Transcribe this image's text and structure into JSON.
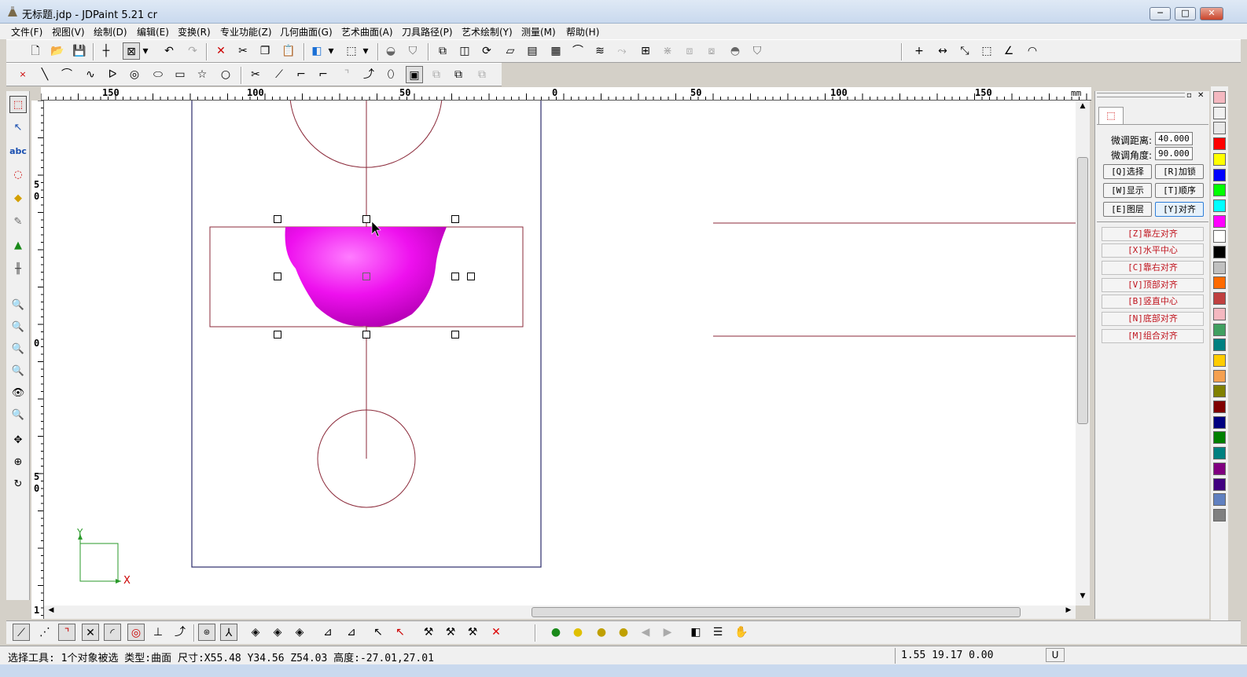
{
  "window": {
    "title": "无标题.jdp - JDPaint 5.21 cr",
    "minimize": "─",
    "maximize": "□",
    "close": "✕"
  },
  "menu": [
    "文件(F)",
    "视图(V)",
    "绘制(D)",
    "编辑(E)",
    "变换(R)",
    "专业功能(Z)",
    "几何曲面(G)",
    "艺术曲面(A)",
    "刀具路径(P)",
    "艺术绘制(Y)",
    "测量(M)",
    "帮助(H)"
  ],
  "ruler_top": {
    "labels": [
      "150",
      "100",
      "50",
      "0",
      "50",
      "100",
      "150"
    ],
    "unit": "mm"
  },
  "ruler_left": {
    "labels": [
      "5\n0",
      "0",
      "5\n0",
      "1"
    ]
  },
  "canvas": {
    "axis_y": "Y",
    "axis_x": "X",
    "surface_color": "#ee10ee",
    "line_color": "#8b2a3a",
    "frame_color": "#2b2b6b"
  },
  "right_panel": {
    "fine_dist_label": "微调距离:",
    "fine_dist_value": "40.000",
    "fine_angle_label": "微调角度:",
    "fine_angle_value": "90.000",
    "buttons": [
      [
        "[Q]选择",
        "[R]加锁"
      ],
      [
        "[W]显示",
        "[T]顺序"
      ],
      [
        "[E]图层",
        "[Y]对齐"
      ]
    ],
    "align_buttons": [
      "[Z]靠左对齐",
      "[X]水平中心",
      "[C]靠右对齐",
      "[V]顶部对齐",
      "[B]竖直中心",
      "[N]底部对齐",
      "[M]组合对齐"
    ]
  },
  "palette": [
    "#f4b8c0",
    "#f0f0f0",
    "#e8e8e8",
    "#ff0000",
    "#ffff00",
    "#0000ff",
    "#00ff00",
    "#00ffff",
    "#ff00ff",
    "#ffffff",
    "#000000",
    "#c0c0c0",
    "#ff6a00",
    "#c04040",
    "#f4b8c0",
    "#40a060",
    "#008080",
    "#ffcc00",
    "#f5a050",
    "#808000",
    "#800000",
    "#000080",
    "#008000",
    "#008080",
    "#800080",
    "#400080",
    "#6080c0",
    "#808080"
  ],
  "status": {
    "message": "选择工具: 1个对象被选 类型:曲面 尺寸:X55.48 Y34.56 Z54.03 高度:-27.01,27.01",
    "coords": "1.55 19.17 0.00",
    "mode": "U"
  }
}
